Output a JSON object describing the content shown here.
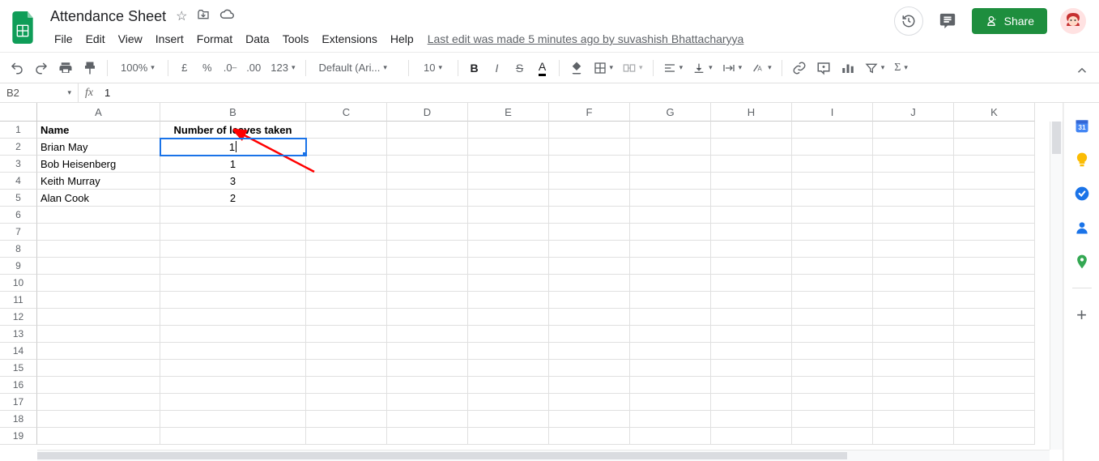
{
  "doc_title": "Attendance Sheet",
  "menus": [
    "File",
    "Edit",
    "View",
    "Insert",
    "Format",
    "Data",
    "Tools",
    "Extensions",
    "Help"
  ],
  "last_edit": "Last edit was made 5 minutes ago by suvashish Bhattacharyya",
  "share_label": "Share",
  "toolbar": {
    "zoom": "100%",
    "currency": "£",
    "percent": "%",
    "fmt123": "123",
    "font": "Default (Ari...",
    "font_size": "10"
  },
  "namebox": "B2",
  "formula": "1",
  "columns": [
    "A",
    "B",
    "C",
    "D",
    "E",
    "F",
    "G",
    "H",
    "I",
    "J",
    "K"
  ],
  "rows": 19,
  "headers": {
    "A": "Name",
    "B": "Number of leaves taken"
  },
  "data": [
    {
      "name": "Brian May",
      "leaves": "1"
    },
    {
      "name": "Bob Heisenberg",
      "leaves": "1"
    },
    {
      "name": "Keith  Murray",
      "leaves": "3"
    },
    {
      "name": "Alan Cook",
      "leaves": "2"
    }
  ],
  "selected": {
    "row": 2,
    "col": "B"
  }
}
